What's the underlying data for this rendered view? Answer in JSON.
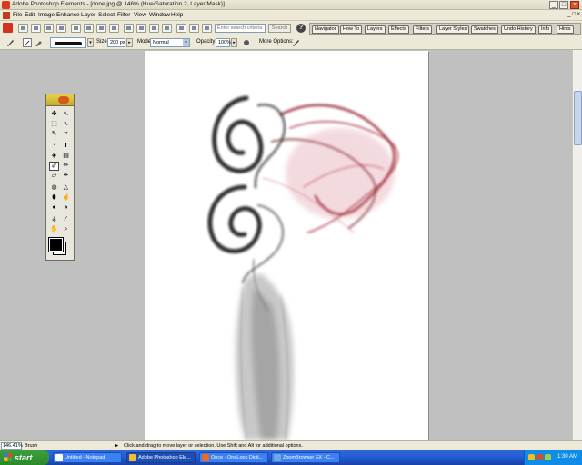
{
  "window": {
    "title": "Adobe Photoshop Elements - [done.jpg @ 146% (Hue/Saturation 2, Layer Mask)]",
    "controls": [
      "_",
      "□",
      "×"
    ]
  },
  "menu": {
    "items": [
      "File",
      "Edit",
      "Image",
      "Enhance",
      "Layer",
      "Select",
      "Filter",
      "View",
      "Window",
      "Help"
    ],
    "doc_controls": "_ □ ×"
  },
  "shortcuts": {
    "search_placeholder": "Enter search criteria",
    "search_button": "Search",
    "help_icon": "?",
    "palette_tabs": [
      "Navigator",
      "How To",
      "Layers",
      "Effects",
      "Filters",
      "Layer Styles",
      "Swatches",
      "Undo History",
      "Info",
      "Hints"
    ]
  },
  "options": {
    "size_label": "Size:",
    "size_value": "200 px",
    "mode_label": "Mode:",
    "mode_value": "Normal",
    "opacity_label": "Opacity:",
    "opacity_value": "100%",
    "more_options_label": "More Options:"
  },
  "status": {
    "zoom": "146.41%",
    "tool": "Brush",
    "hint": "Click and drag to move layer or selection. Use Shift and Alt for additional options."
  },
  "taskbar": {
    "start": "start",
    "tasks": [
      "Untitled - Notepad",
      "Adobe Photoshop Ele...",
      "Once - OneLook Dicti...",
      "ZoomBrowser EX - C..."
    ],
    "clock": "1:30 AM"
  },
  "colors": {
    "smoke_black": "#101010",
    "smoke_red": "#8a1020",
    "taskbar_blue": "#245edb",
    "start_green": "#2a8a2a"
  }
}
